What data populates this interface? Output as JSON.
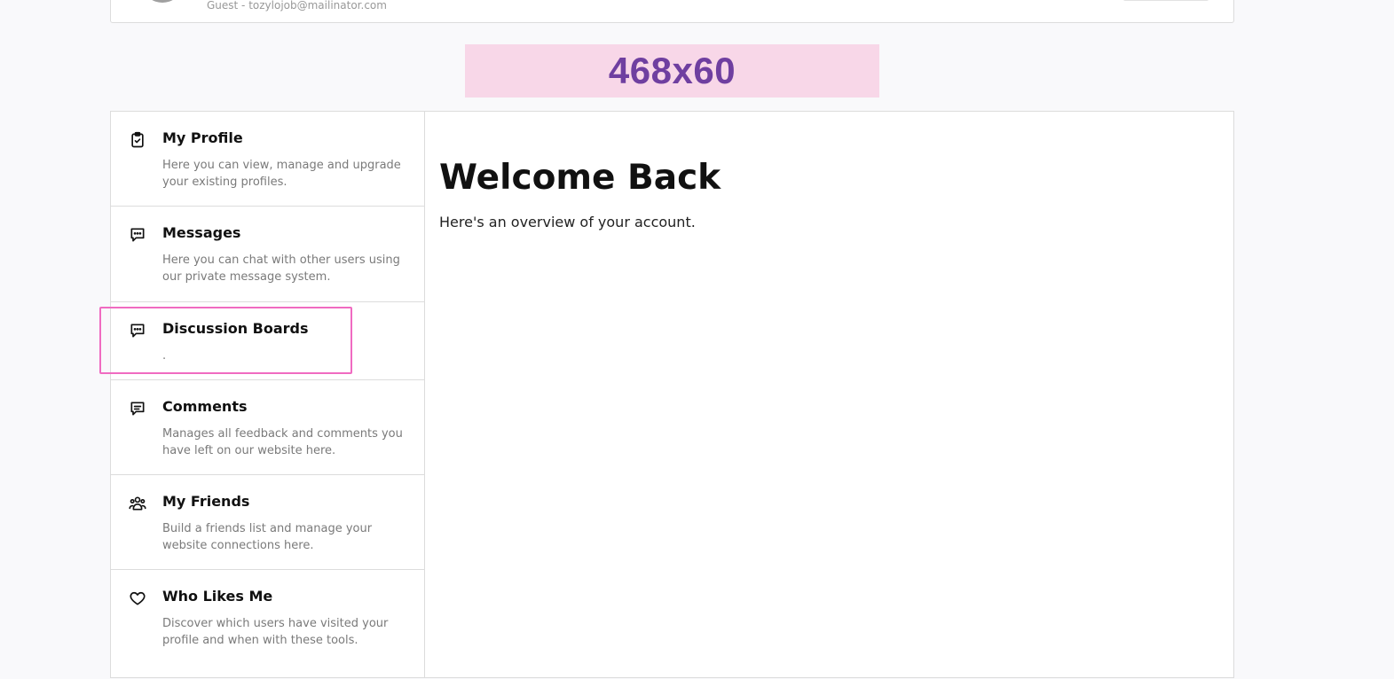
{
  "header": {
    "user_line": "Guest - tozylojob@mailinator.com"
  },
  "banner": {
    "text": "468x60"
  },
  "sidebar": {
    "items": [
      {
        "icon": "clipboard-check-icon",
        "title": "My Profile",
        "desc": "Here you can view, manage and upgrade your existing profiles."
      },
      {
        "icon": "chat-bubble-icon",
        "title": "Messages",
        "desc": "Here you can chat with other users using our private message system."
      },
      {
        "icon": "chat-bubble-icon",
        "title": "Discussion Boards",
        "desc": "."
      },
      {
        "icon": "comment-lines-icon",
        "title": "Comments",
        "desc": "Manages all feedback and comments you have left on our website here."
      },
      {
        "icon": "users-group-icon",
        "title": "My Friends",
        "desc": "Build a friends list and manage your website connections here."
      },
      {
        "icon": "heart-icon",
        "title": "Who Likes Me",
        "desc": "Discover which users have visited your profile and when with these tools."
      }
    ]
  },
  "main": {
    "title": "Welcome Back",
    "subtitle": "Here's an overview of your account."
  }
}
